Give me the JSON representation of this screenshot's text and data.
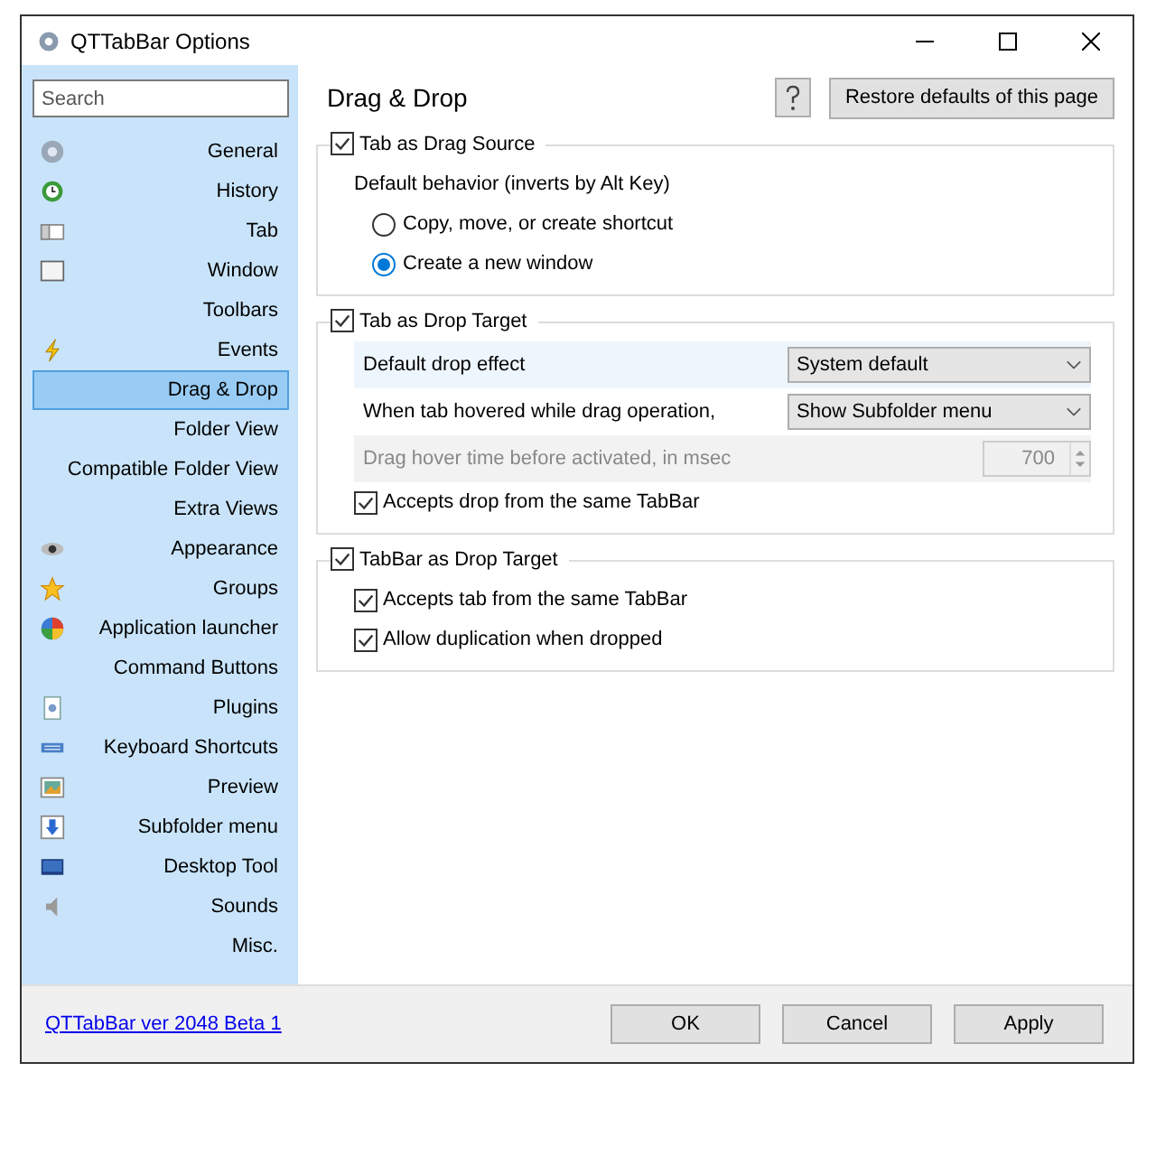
{
  "window": {
    "title": "QTTabBar Options"
  },
  "sidebar": {
    "search": {
      "placeholder": "Search"
    },
    "items": [
      {
        "label": "General",
        "selected": false
      },
      {
        "label": "History",
        "selected": false
      },
      {
        "label": "Tab",
        "selected": false
      },
      {
        "label": "Window",
        "selected": false
      },
      {
        "label": "Toolbars",
        "selected": false
      },
      {
        "label": "Events",
        "selected": false
      },
      {
        "label": "Drag & Drop",
        "selected": true
      },
      {
        "label": "Folder View",
        "selected": false
      },
      {
        "label": "Compatible Folder View",
        "selected": false
      },
      {
        "label": "Extra Views",
        "selected": false
      },
      {
        "label": "Appearance",
        "selected": false
      },
      {
        "label": "Groups",
        "selected": false
      },
      {
        "label": "Application launcher",
        "selected": false
      },
      {
        "label": "Command Buttons",
        "selected": false
      },
      {
        "label": "Plugins",
        "selected": false
      },
      {
        "label": "Keyboard Shortcuts",
        "selected": false
      },
      {
        "label": "Preview",
        "selected": false
      },
      {
        "label": "Subfolder menu",
        "selected": false
      },
      {
        "label": "Desktop Tool",
        "selected": false
      },
      {
        "label": "Sounds",
        "selected": false
      },
      {
        "label": "Misc.",
        "selected": false
      }
    ]
  },
  "page": {
    "heading": "Drag & Drop",
    "restore_button": "Restore defaults of this page"
  },
  "groups": [
    {
      "title": "Tab as Drag Source",
      "checked": true,
      "items": [
        {
          "kind": "label",
          "label": "Default behavior (inverts by Alt Key)"
        },
        {
          "kind": "radio",
          "label": "Copy, move, or create shortcut",
          "selected": false
        },
        {
          "kind": "radio",
          "label": "Create a new window",
          "selected": true
        }
      ]
    },
    {
      "title": "Tab as Drop Target",
      "checked": true,
      "items": [
        {
          "kind": "dropdown",
          "label": "Default drop effect",
          "value": "System default",
          "highlighted": true
        },
        {
          "kind": "dropdown",
          "label": "When tab hovered while drag operation,",
          "value": "Show Subfolder menu",
          "highlighted": false
        },
        {
          "kind": "spinner",
          "label": "Drag hover time before activated, in msec",
          "value": "700",
          "disabled": true
        },
        {
          "kind": "checkbox",
          "label": "Accepts drop from the same TabBar",
          "checked": true
        }
      ]
    },
    {
      "title": "TabBar as Drop Target",
      "checked": true,
      "items": [
        {
          "kind": "checkbox",
          "label": "Accepts tab from the same TabBar",
          "checked": true
        },
        {
          "kind": "checkbox",
          "label": "Allow duplication when dropped",
          "checked": true
        }
      ]
    }
  ],
  "footer": {
    "version_link": "QTTabBar ver 2048 Beta 1",
    "buttons": [
      "OK",
      "Cancel",
      "Apply"
    ]
  }
}
